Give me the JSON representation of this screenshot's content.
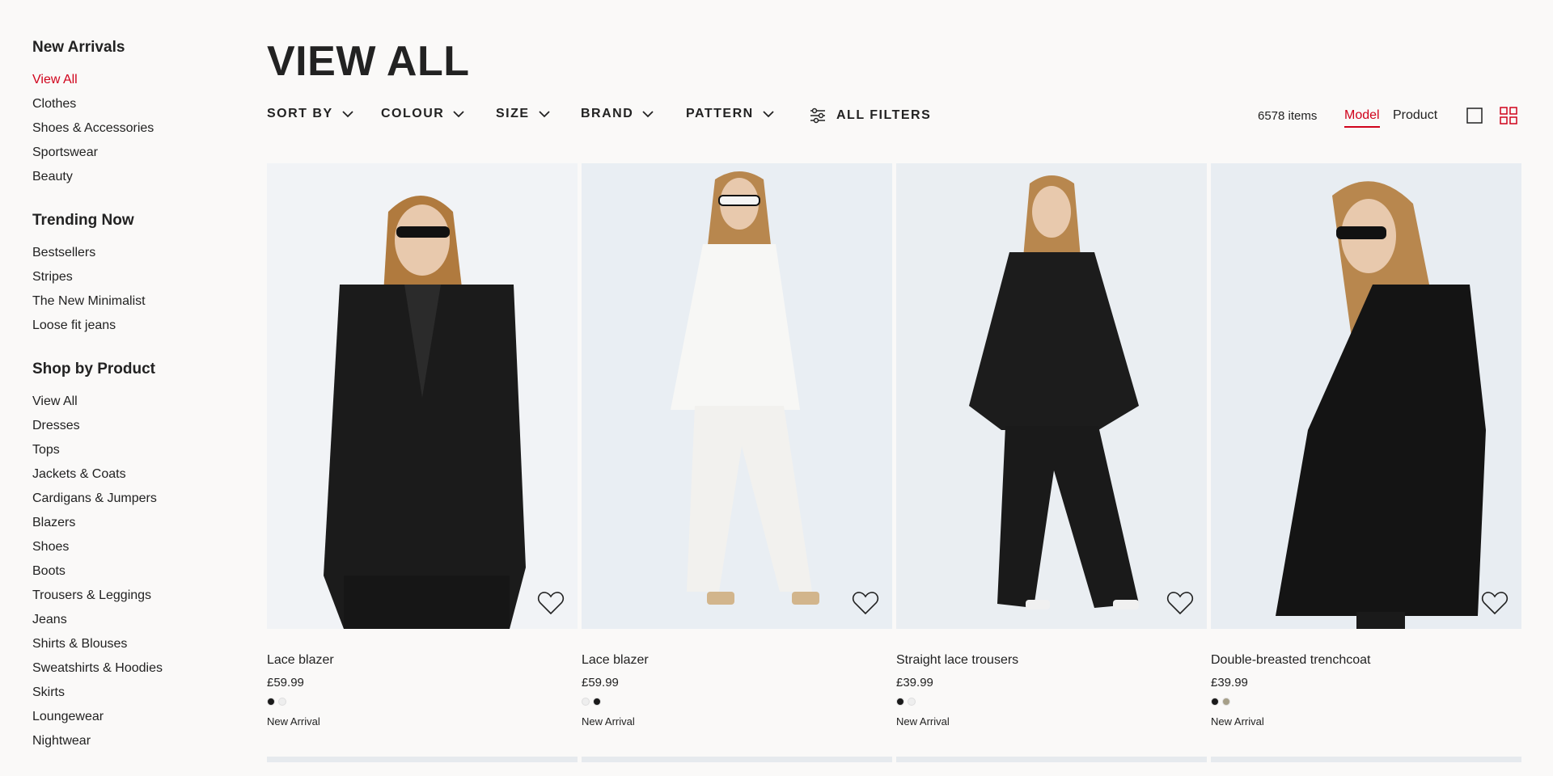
{
  "sidebar": {
    "sections": [
      {
        "heading": "New Arrivals",
        "items": [
          "View All",
          "Clothes",
          "Shoes & Accessories",
          "Sportswear",
          "Beauty"
        ]
      },
      {
        "heading": "Trending Now",
        "items": [
          "Bestsellers",
          "Stripes",
          "The New Minimalist",
          "Loose fit jeans"
        ]
      },
      {
        "heading": "Shop by Product",
        "items": [
          "View All",
          "Dresses",
          "Tops",
          "Jackets & Coats",
          "Cardigans & Jumpers",
          "Blazers",
          "Shoes",
          "Boots",
          "Trousers & Leggings",
          "Jeans",
          "Shirts & Blouses",
          "Sweatshirts & Hoodies",
          "Skirts",
          "Loungewear",
          "Nightwear"
        ]
      }
    ],
    "active_item": "View All"
  },
  "page": {
    "title": "VIEW ALL"
  },
  "filters": {
    "sort_by": "SORT BY",
    "colour": "COLOUR",
    "size": "SIZE",
    "brand": "BRAND",
    "pattern": "PATTERN",
    "all_filters": "ALL FILTERS"
  },
  "toolbar": {
    "items_count": "6578 items",
    "model_label": "Model",
    "product_label": "Product",
    "active_view": "Model",
    "single_view_icon": "square-icon",
    "grid_view_icon": "grid-four-icon"
  },
  "colors": {
    "accent": "#d0021b",
    "text": "#222222",
    "background": "#faf9f8"
  },
  "products": [
    {
      "name": "Lace blazer",
      "price": "£59.99",
      "swatches": [
        "#1a1a1a",
        "#eeeeee"
      ],
      "badge": "New Arrival"
    },
    {
      "name": "Lace blazer",
      "price": "£59.99",
      "swatches": [
        "#eeeeee",
        "#1a1a1a"
      ],
      "badge": "New Arrival"
    },
    {
      "name": "Straight lace trousers",
      "price": "£39.99",
      "swatches": [
        "#1a1a1a",
        "#eeeeee"
      ],
      "badge": "New Arrival"
    },
    {
      "name": "Double-breasted trenchcoat",
      "price": "£39.99",
      "swatches": [
        "#1a1a1a",
        "#a69f88"
      ],
      "badge": "New Arrival"
    }
  ]
}
